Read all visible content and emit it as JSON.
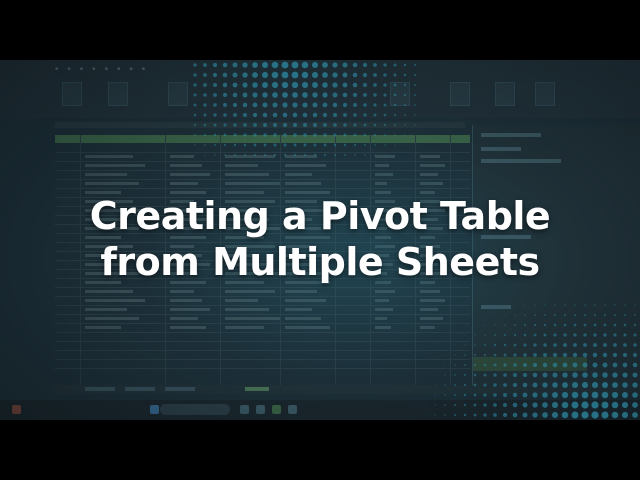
{
  "title": {
    "line1": "Creating a Pivot Table",
    "line2": "from Multiple Sheets"
  },
  "colors": {
    "letterbox": "#000000",
    "background": "#1d2f38",
    "accent_teal": "#2f8fa8",
    "title_text": "#ffffff",
    "header_green": "#3d6a49"
  },
  "icons": [
    "dot-pattern-top",
    "dot-pattern-bottom-right",
    "windows-start-icon",
    "search-icon"
  ]
}
